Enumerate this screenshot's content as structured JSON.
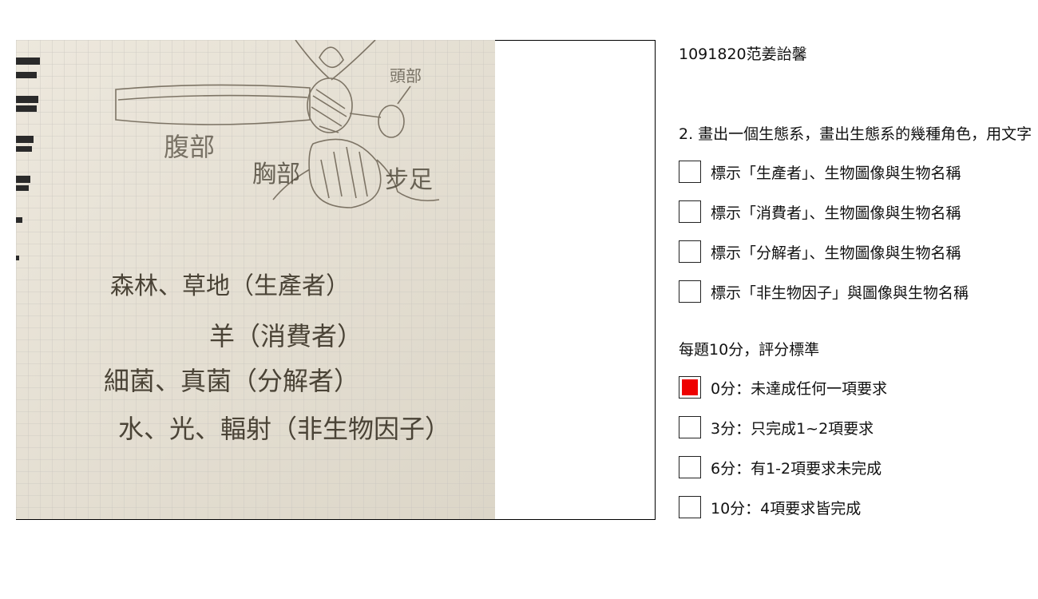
{
  "header": {
    "student_id": "1091820范姜詒馨"
  },
  "question": {
    "text": "2. 畫出一個生態系，畫出生態系的幾種角色，用文字"
  },
  "requirements": [
    {
      "label": "標示「生產者」、生物圖像與生物名稱",
      "checked": false
    },
    {
      "label": "標示「消費者」、生物圖像與生物名稱",
      "checked": false
    },
    {
      "label": "標示「分解者」、生物圖像與生物名稱",
      "checked": false
    },
    {
      "label": "標示「非生物因子」與圖像與生物名稱",
      "checked": false
    }
  ],
  "scoring": {
    "title": "每題10分，評分標準",
    "options": [
      {
        "label": "0分：未達成任何一項要求",
        "checked": true
      },
      {
        "label": "3分：只完成1~2項要求",
        "checked": false
      },
      {
        "label": "6分：有1-2項要求未完成",
        "checked": false
      },
      {
        "label": "10分：4項要求皆完成",
        "checked": false
      }
    ]
  },
  "photo": {
    "labels": {
      "abdomen": "腹部",
      "head": "頭部",
      "chest": "胸部",
      "legs": "步足",
      "producer_line": "森林、草地（生產者）",
      "consumer_line": "羊（消費者）",
      "decomposer_line": "細菌、真菌（分解者）",
      "abiotic_line": "水、光、輻射（非生物因子）"
    }
  },
  "colors": {
    "checked_fill": "#ee0000",
    "paper": "#e9e3d6",
    "grid": "#c9c6bf",
    "pencil": "#4a4336"
  }
}
